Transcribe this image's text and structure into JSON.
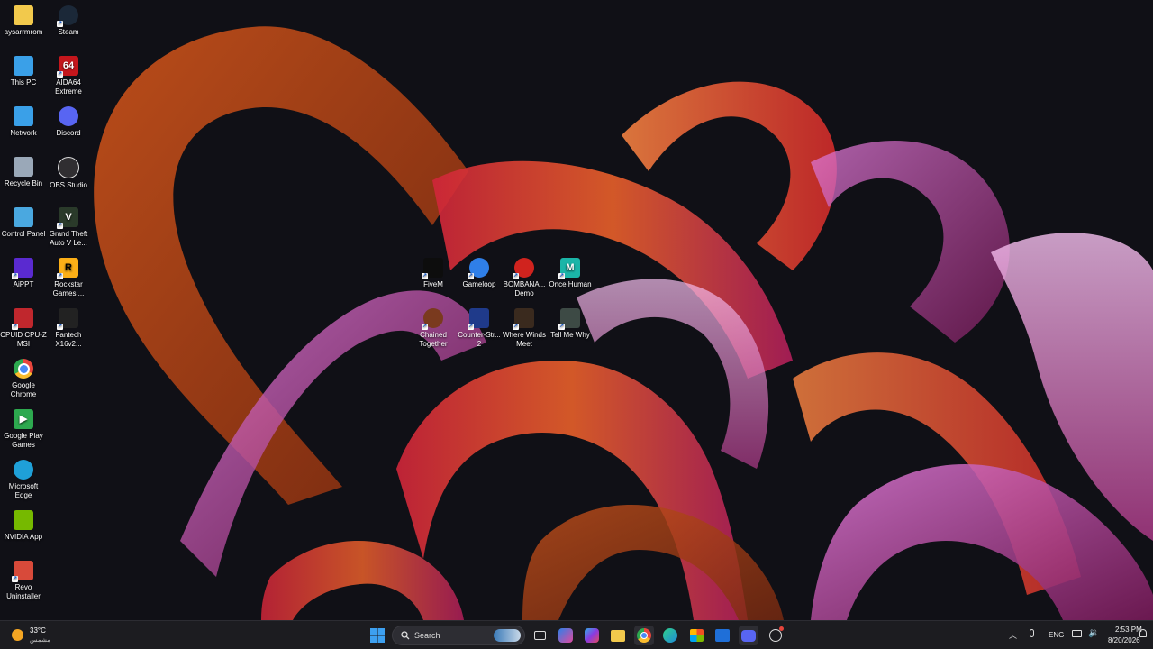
{
  "desktop": {
    "left_icons": [
      {
        "label": "aysarrmrom",
        "icon": "folder-icon",
        "color": "#f2c94c"
      },
      {
        "label": "This PC",
        "icon": "monitor-icon",
        "color": "#3aa0e8"
      },
      {
        "label": "Network",
        "icon": "network-icon",
        "color": "#3aa0e8"
      },
      {
        "label": "Recycle Bin",
        "icon": "recycle-bin-icon",
        "color": "#9aa8b8"
      },
      {
        "label": "Control Panel",
        "icon": "control-panel-icon",
        "color": "#4aa8e0"
      },
      {
        "label": "AiPPT",
        "icon": "aippt-icon",
        "color": "#5a2ad0"
      },
      {
        "label": "CPUID CPU-Z MSI",
        "icon": "cpuz-icon",
        "color": "#c0272d"
      },
      {
        "label": "Google Chrome",
        "icon": "chrome-icon",
        "color": "#e8453c"
      },
      {
        "label": "Google Play Games",
        "icon": "play-games-icon",
        "color": "#2da94f"
      },
      {
        "label": "Microsoft Edge",
        "icon": "edge-icon",
        "color": "#1fa0d8"
      },
      {
        "label": "NVIDIA App",
        "icon": "nvidia-icon",
        "color": "#76b900"
      },
      {
        "label": "Revo Uninstaller",
        "icon": "revo-icon",
        "color": "#d84a3a"
      }
    ],
    "second_column_icons": [
      {
        "label": "Steam",
        "icon": "steam-icon",
        "color": "#1b2838"
      },
      {
        "label": "AIDA64 Extreme",
        "icon": "aida64-icon",
        "color": "#c4161c"
      },
      {
        "label": "Discord",
        "icon": "discord-icon",
        "color": "#5865f2"
      },
      {
        "label": "OBS Studio",
        "icon": "obs-icon",
        "color": "#302e31"
      },
      {
        "label": "Grand Theft Auto V Le...",
        "icon": "gta-icon",
        "color": "#2a3a2a"
      },
      {
        "label": "Rockstar Games ...",
        "icon": "rockstar-icon",
        "color": "#fcaf17"
      },
      {
        "label": "Fantech X16v2...",
        "icon": "fantech-icon",
        "color": "#222222"
      }
    ],
    "center_icons": [
      {
        "label": "FiveM",
        "icon": "fivem-icon",
        "color": "#0d0d0d"
      },
      {
        "label": "Gameloop",
        "icon": "gameloop-icon",
        "color": "#2f7fe8"
      },
      {
        "label": "BOMBANA... Demo",
        "icon": "bombana-icon",
        "color": "#d0231e"
      },
      {
        "label": "Once Human",
        "icon": "once-human-icon",
        "color": "#1bb5a8"
      },
      {
        "label": "Chained Together",
        "icon": "chained-together-icon",
        "color": "#7a3a1e"
      },
      {
        "label": "Counter-Str... 2",
        "icon": "counter-strike-icon",
        "color": "#1f3a8a"
      },
      {
        "label": "Where Winds Meet",
        "icon": "where-winds-meet-icon",
        "color": "#3a2a1e"
      },
      {
        "label": "Tell Me Why",
        "icon": "tell-me-why-icon",
        "color": "#3d4a45"
      }
    ]
  },
  "taskbar": {
    "weather": {
      "temp": "33°C",
      "condition": "مشمس"
    },
    "search_placeholder": "Search",
    "apps": [
      {
        "icon": "start-icon"
      },
      {
        "icon": "search-icon"
      },
      {
        "icon": "task-view-icon"
      },
      {
        "icon": "copilot-icon"
      },
      {
        "icon": "m365-icon"
      },
      {
        "icon": "file-explorer-icon"
      },
      {
        "icon": "chrome-icon"
      },
      {
        "icon": "edge-icon"
      },
      {
        "icon": "store-icon"
      },
      {
        "icon": "outlook-icon"
      },
      {
        "icon": "discord-icon"
      },
      {
        "icon": "obs-icon"
      }
    ],
    "tray": {
      "language": "ENG",
      "time": "2:53 PM",
      "date": "8/20/2026"
    }
  }
}
